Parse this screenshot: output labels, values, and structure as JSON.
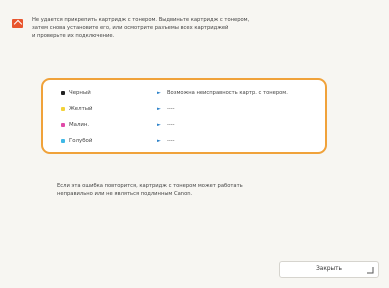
{
  "message": {
    "lines": [
      "Не удается прикрепить картридж с тонером. Выдвиньте картридж с тонером,",
      "затем снова установите его, или осмотрите разъемы всех картриджей",
      "и проверьте их подключение."
    ]
  },
  "toner_status": [
    {
      "color_name": "Черный",
      "dot_color": "#222222",
      "status": "Возможна неисправность картр. с тонером."
    },
    {
      "color_name": "Желтый",
      "dot_color": "#f3d23a",
      "status": "----"
    },
    {
      "color_name": "Малин.",
      "dot_color": "#e04aa8",
      "status": "----"
    },
    {
      "color_name": "Голубой",
      "dot_color": "#3fb8e6",
      "status": "----"
    }
  ],
  "note": {
    "lines": [
      "Если эта ошибка повторится, картридж с тонером может работать",
      "неправильно или не являться подлинным Canon."
    ]
  },
  "close_button": {
    "label": "Закрыть"
  },
  "colors": {
    "accent_border": "#f0a23a",
    "error_icon": "#e8552e",
    "arrow": "#2a80c8"
  }
}
